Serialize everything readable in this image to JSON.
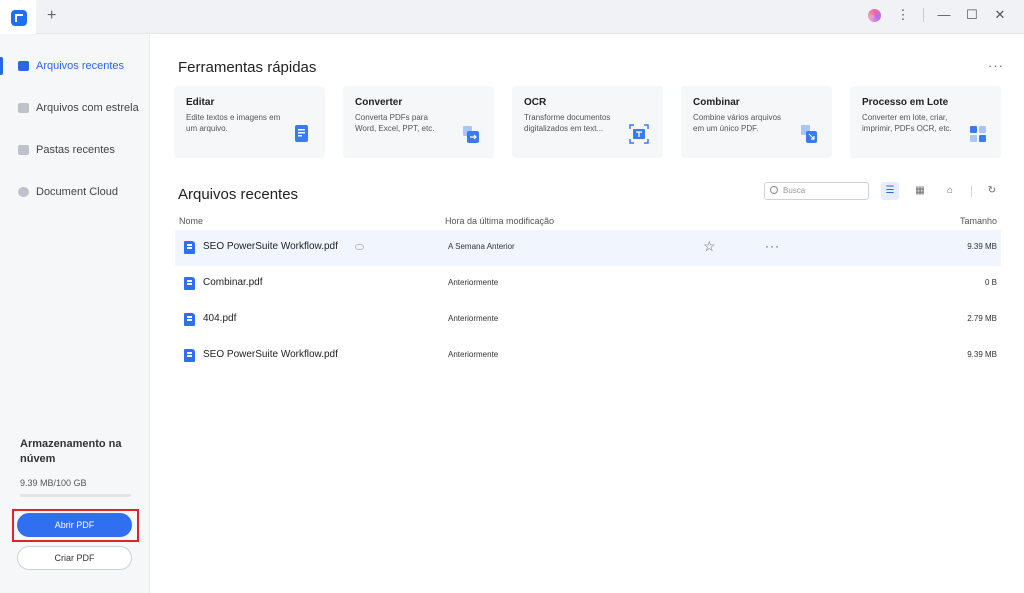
{
  "titlebar": {
    "new_tab": "+",
    "more": "⋮",
    "minimize": "—",
    "maximize": "☐",
    "close": "✕"
  },
  "sidebar": {
    "items": [
      {
        "label": "Arquivos recentes",
        "active": true
      },
      {
        "label": "Arquivos com estrela",
        "active": false
      },
      {
        "label": "Pastas recentes",
        "active": false
      },
      {
        "label": "Document Cloud",
        "active": false
      }
    ],
    "storage_title": "Armazenamento na núvem",
    "storage_value": "9.39 MB/100 GB",
    "storage_used_fraction": 0.0001,
    "open_label": "Abrir PDF",
    "create_label": "Criar PDF"
  },
  "quick_tools": {
    "title": "Ferramentas rápidas",
    "more": "···",
    "cards": [
      {
        "title": "Editar",
        "desc": "Edite textos e imagens em um arquivo."
      },
      {
        "title": "Converter",
        "desc": "Converta PDFs para Word, Excel, PPT, etc."
      },
      {
        "title": "OCR",
        "desc": "Transforme documentos digitalizados em text..."
      },
      {
        "title": "Combinar",
        "desc": "Combine vários arquivos em um único PDF."
      },
      {
        "title": "Processo em Lote",
        "desc": "Converter em lote, criar, imprimir, PDFs OCR, etc."
      }
    ]
  },
  "recent": {
    "title": "Arquivos recentes",
    "search_placeholder": "Busca",
    "columns": {
      "name": "Nome",
      "modified": "Hora da última modificação",
      "size": "Tamanho"
    },
    "row_more": "···",
    "star": "☆",
    "rows": [
      {
        "name": "SEO PowerSuite Workflow.pdf",
        "modified": "A Semana Anterior",
        "size": "9.39 MB"
      },
      {
        "name": "Combinar.pdf",
        "modified": "Anteriormente",
        "size": "0 B"
      },
      {
        "name": "404.pdf",
        "modified": "Anteriormente",
        "size": "2.79 MB"
      },
      {
        "name": "SEO PowerSuite Workflow.pdf",
        "modified": "Anteriormente",
        "size": "9.39 MB"
      }
    ]
  },
  "colors": {
    "accent": "#2f6ff0",
    "highlight": "#e0242c"
  }
}
